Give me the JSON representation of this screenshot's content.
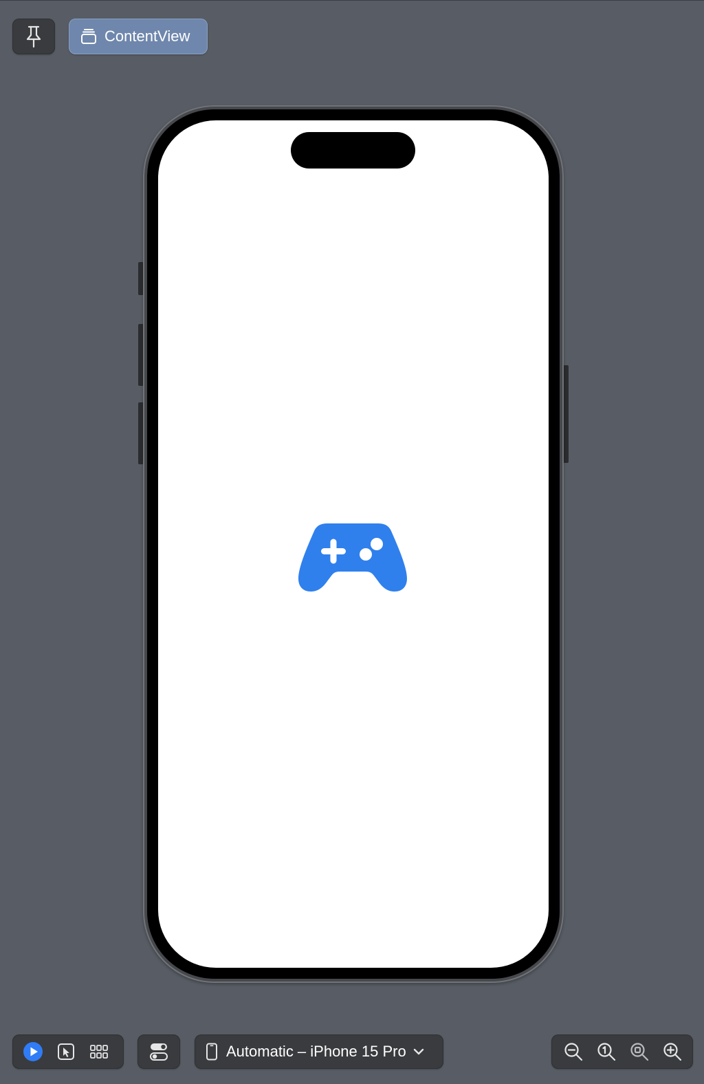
{
  "toolbar_top": {
    "pin_icon": "pin-icon",
    "content_view_label": "ContentView",
    "content_view_icon": "stack-icon"
  },
  "preview": {
    "device_frame": "iPhone 15 Pro",
    "content_icon": "gamecontroller-icon",
    "content_icon_color": "#2f80ed",
    "screen_background": "#ffffff"
  },
  "toolbar_bottom": {
    "live_icon": "play-circle-icon",
    "selectable_icon": "cursor-select-icon",
    "variants_icon": "grid-icon",
    "settings_icon": "toggles-icon",
    "device_icon": "iphone-icon",
    "device_label": "Automatic – iPhone 15 Pro",
    "device_chevron": "chevron-down-icon",
    "zoom_out_icon": "zoom-out-icon",
    "zoom_actual_icon": "zoom-100-icon",
    "zoom_fit_icon": "zoom-fit-icon",
    "zoom_in_icon": "zoom-in-icon"
  },
  "colors": {
    "canvas": "#585d65",
    "accent": "#2f80ed",
    "selected_button": "#6f87ac"
  }
}
